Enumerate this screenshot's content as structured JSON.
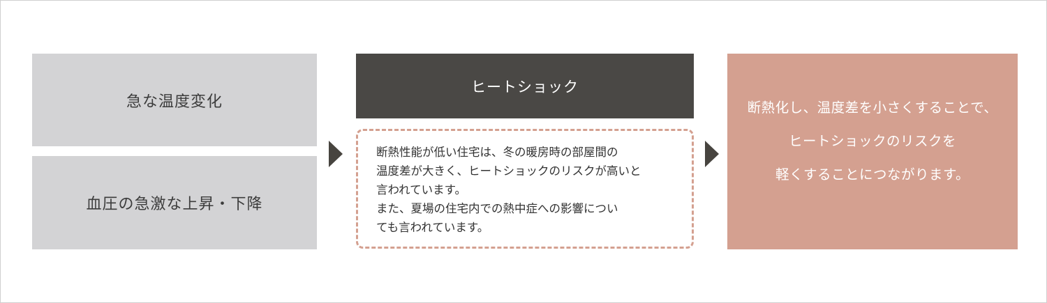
{
  "causes": {
    "sudden_temp_change": "急な温度変化",
    "blood_pressure_change": "血圧の急激な上昇・下降"
  },
  "heat_shock": {
    "title": "ヒートショック",
    "description_lines": [
      "断熱性能が低い住宅は、冬の暖房時の部屋間の",
      "温度差が大きく、ヒートショックのリスクが高いと",
      "言われています。",
      "また、夏場の住宅内での熱中症への影響につい",
      "ても言われています。"
    ]
  },
  "result": {
    "lines": [
      "断熱化し、温度差を小さくすることで、",
      "ヒートショックのリスクを",
      "軽くすることにつながります。"
    ]
  },
  "colors": {
    "gray_box": "#d3d3d5",
    "dark_header": "#4a4845",
    "accent_pink": "#d4a090",
    "arrow": "#47443f"
  }
}
